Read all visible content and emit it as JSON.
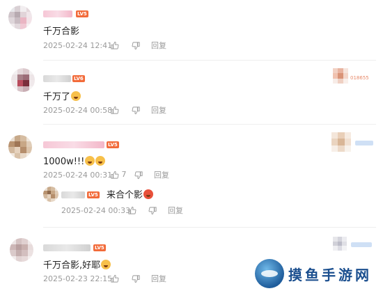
{
  "comments": [
    {
      "level": "LV5",
      "text": "千万合影",
      "time": "2025-02-24 12:41",
      "reply_label": "回复",
      "reply_count": ""
    },
    {
      "level": "LV6",
      "text": "千万了",
      "time": "2025-02-24 00:58",
      "reply_label": "回复",
      "side_thumb_text": "018655"
    },
    {
      "level": "LV5",
      "text": "1000w!!!",
      "time": "2025-02-24 00:31",
      "like_count": "7",
      "reply_label": "回复",
      "reply": {
        "level": "LV5",
        "text": "来合个影",
        "time": "2025-02-24 00:33",
        "reply_label": "回复"
      }
    },
    {
      "level": "LV5",
      "text": "千万合影,好耶",
      "time": "2025-02-23 22:15",
      "reply_label": "回复"
    }
  ],
  "watermark": {
    "text": "摸鱼手游网"
  },
  "colors": {
    "level_badge": "#f26b3a",
    "meta_text": "#9a9a9a"
  }
}
